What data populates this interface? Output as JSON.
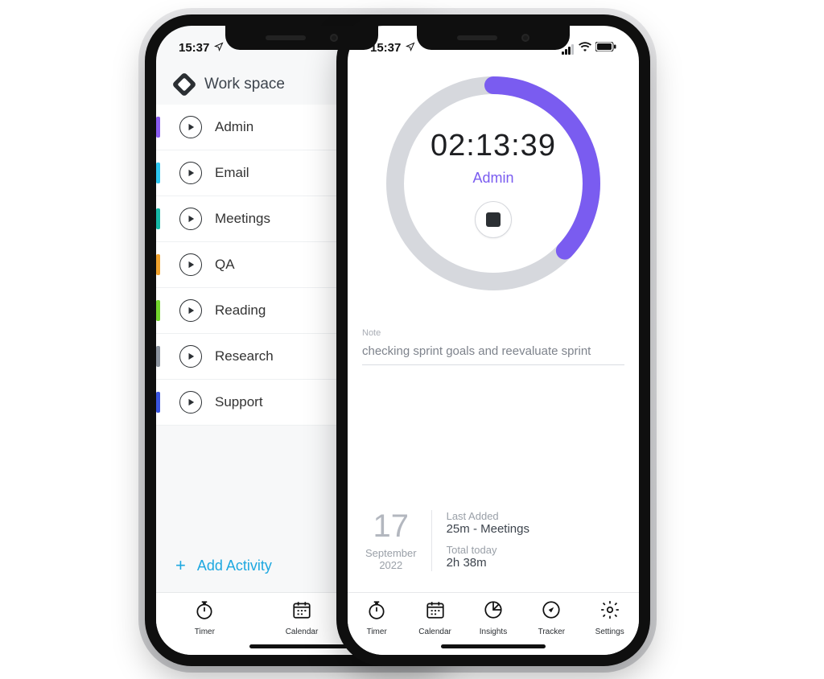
{
  "status": {
    "time": "15:37"
  },
  "left_phone": {
    "workspace": {
      "title": "Work space"
    },
    "activities": [
      {
        "label": "Admin",
        "color": "#8a5cf0"
      },
      {
        "label": "Email",
        "color": "#2ec6f0"
      },
      {
        "label": "Meetings",
        "color": "#17b9a7"
      },
      {
        "label": "QA",
        "color": "#f0a22e"
      },
      {
        "label": "Reading",
        "color": "#74d62e"
      },
      {
        "label": "Research",
        "color": "#8d95a0"
      },
      {
        "label": "Support",
        "color": "#3a55e0"
      }
    ],
    "add_activity": "Add Activity",
    "tabs": [
      {
        "label": "Timer"
      },
      {
        "label": "Calendar"
      },
      {
        "label": "Insights"
      }
    ]
  },
  "right_phone": {
    "timer": {
      "elapsed": "02:13:39",
      "activity": "Admin",
      "progress_pct": 37,
      "ring_color": "#7a5cf0",
      "ring_track": "#d6d8dd"
    },
    "note": {
      "label": "Note",
      "value": "checking sprint goals and reevaluate sprint"
    },
    "day": {
      "num": "17",
      "month": "September",
      "year": "2022",
      "last_added_label": "Last Added",
      "last_added_value": "25m - Meetings",
      "total_label": "Total today",
      "total_value": "2h 38m"
    },
    "tabs": [
      {
        "label": "Timer"
      },
      {
        "label": "Calendar"
      },
      {
        "label": "Insights"
      },
      {
        "label": "Tracker"
      },
      {
        "label": "Settings"
      }
    ]
  }
}
